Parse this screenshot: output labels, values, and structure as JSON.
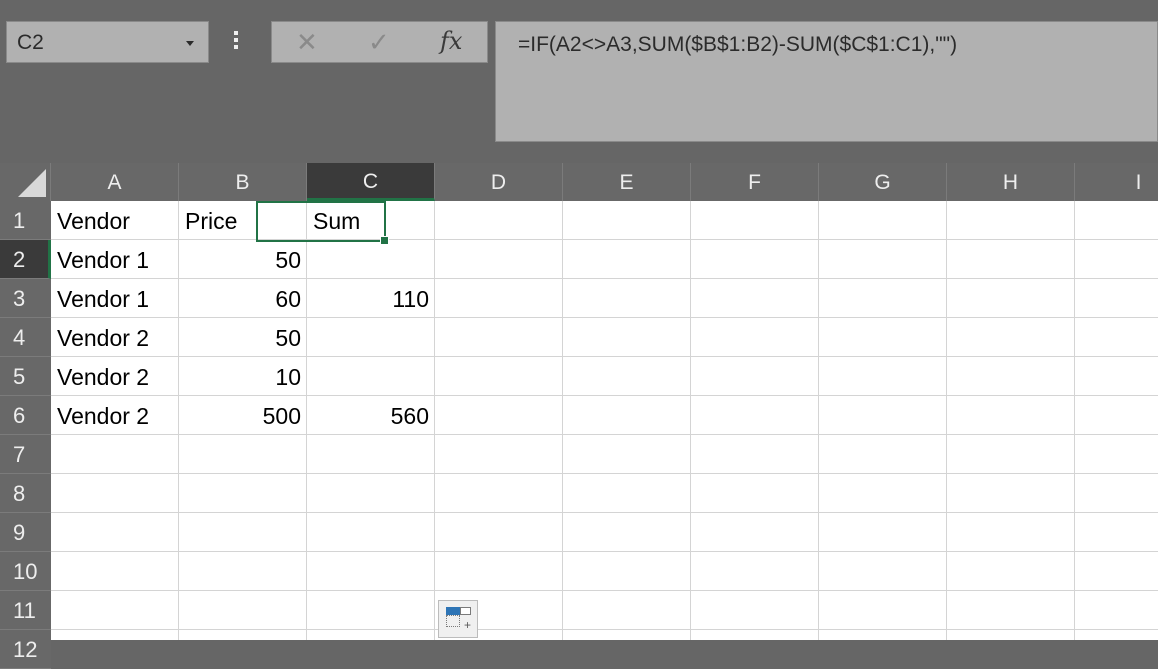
{
  "formula_bar": {
    "name_box": "C2",
    "cancel_icon": "✕",
    "enter_icon": "✓",
    "fx_label": "fx",
    "formula": "=IF(A2<>A3,SUM($B$1:B2)-SUM($C$1:C1),\"\")"
  },
  "columns": [
    "A",
    "B",
    "C",
    "D",
    "E",
    "F",
    "G",
    "H",
    "I"
  ],
  "rows": [
    "1",
    "2",
    "3",
    "4",
    "5",
    "6",
    "7",
    "8",
    "9",
    "10",
    "11",
    "12"
  ],
  "selected_cell": "C2",
  "cells": {
    "A1": "Vendor",
    "B1": "Price",
    "C1": "Sum",
    "A2": "Vendor 1",
    "B2": "50",
    "C2": "",
    "A3": "Vendor 1",
    "B3": "60",
    "C3": "110",
    "A4": "Vendor 2",
    "B4": "50",
    "A5": "Vendor 2",
    "B5": "10",
    "A6": "Vendor 2",
    "B6": "500",
    "C6": "560"
  },
  "colors": {
    "accent_green": "#217346",
    "chrome": "#666666",
    "selected_header": "#3a3a3a"
  },
  "icons": {
    "name_box_dropdown": "chevron-down-icon",
    "more": "vertical-dots-icon",
    "cancel": "close-icon",
    "enter": "checkmark-icon",
    "insert_function": "fx-icon",
    "select_all": "select-all-triangle-icon",
    "paste_options": "paste-options-icon"
  }
}
